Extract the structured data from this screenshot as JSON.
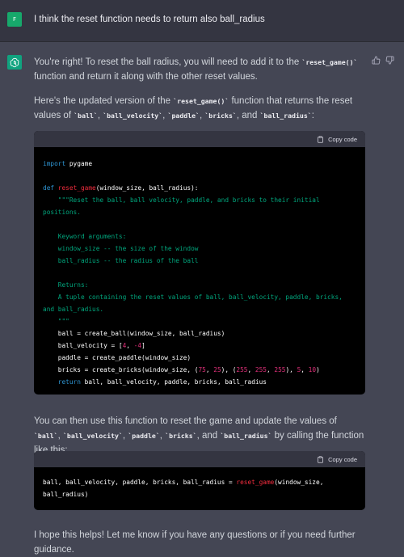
{
  "user": {
    "avatar_letter": "F",
    "message": "I think the reset function needs to return also ball_radius"
  },
  "assistant": {
    "p1": {
      "t1": "You're right! To reset the ball radius, you will need to add it to the ",
      "c1": "`reset_game()`",
      "t2": " function and return it along with the other reset values."
    },
    "p2": {
      "t1": "Here's the updated version of the ",
      "c1": "`reset_game()`",
      "t2": " function that returns the reset values of ",
      "c2": "`ball`",
      "s1": ", ",
      "c3": "`ball_velocity`",
      "s2": ", ",
      "c4": "`paddle`",
      "s3": ", ",
      "c5": "`bricks`",
      "s4": ", and ",
      "c6": "`ball_radius`",
      "s5": ":"
    },
    "p3": {
      "t1": "You can then use this function to reset the game and update the values of ",
      "c1": "`ball`",
      "s1": ", ",
      "c2": "`ball_velocity`",
      "s2": ", ",
      "c3": "`paddle`",
      "s3": ", ",
      "c4": "`bricks`",
      "s4": ", and ",
      "c5": "`ball_radius`",
      "t2": " by calling the function like this:"
    },
    "p4": "I hope this helps! Let me know if you have any questions or if you need further guidance.",
    "copy_label": "Copy code"
  },
  "code1": {
    "l1_kw": "import",
    "l1_rest": " pygame",
    "l3_kw": "def",
    "l3_fn": "reset_game",
    "l3_rest": "(window_size, ball_radius):",
    "doc1": "    \"\"\"Reset the ball, ball velocity, paddle, and bricks to their initial",
    "doc2": "positions.",
    "doc3": "    Keyword arguments:",
    "doc4": "    window_size -- the size of the window",
    "doc5": "    ball_radius -- the radius of the ball",
    "doc6": "    Returns:",
    "doc7": "    A tuple containing the reset values of ball, ball_velocity, paddle, bricks,",
    "doc8": "and ball_radius.",
    "doc9": "    \"\"\"",
    "l17": "    ball = create_ball(window_size, ball_radius)",
    "l18_a": "    ball_velocity = [",
    "l18_n1": "4",
    "l18_b": ", ",
    "l18_n2": "-4",
    "l18_c": "]",
    "l19": "    paddle = create_paddle(window_size)",
    "l20_a": "    bricks = create_bricks(window_size, (",
    "n1": "75",
    "sep1": ", ",
    "n2": "25",
    "l20_b": "), (",
    "n3": "255",
    "sep2": ", ",
    "n4": "255",
    "sep3": ", ",
    "n5": "255",
    "l20_c": "), ",
    "n6": "5",
    "sep4": ", ",
    "n7": "10",
    "l20_d": ")",
    "l21_indent": "    ",
    "l21_kw": "return",
    "l21_rest": " ball, ball_velocity, paddle, bricks, ball_radius"
  },
  "code2": {
    "a": "ball, ball_velocity, paddle, bricks, ball_radius = ",
    "fn": "reset_game",
    "b": "(window_size,",
    "c": "ball_radius)"
  },
  "colors": {
    "user_bg": "#343541",
    "assistant_bg": "#444654",
    "code_bg": "#000000",
    "keyword": "#2e95d3",
    "function": "#f22c3d",
    "string": "#00a67d",
    "number": "#df3079"
  }
}
